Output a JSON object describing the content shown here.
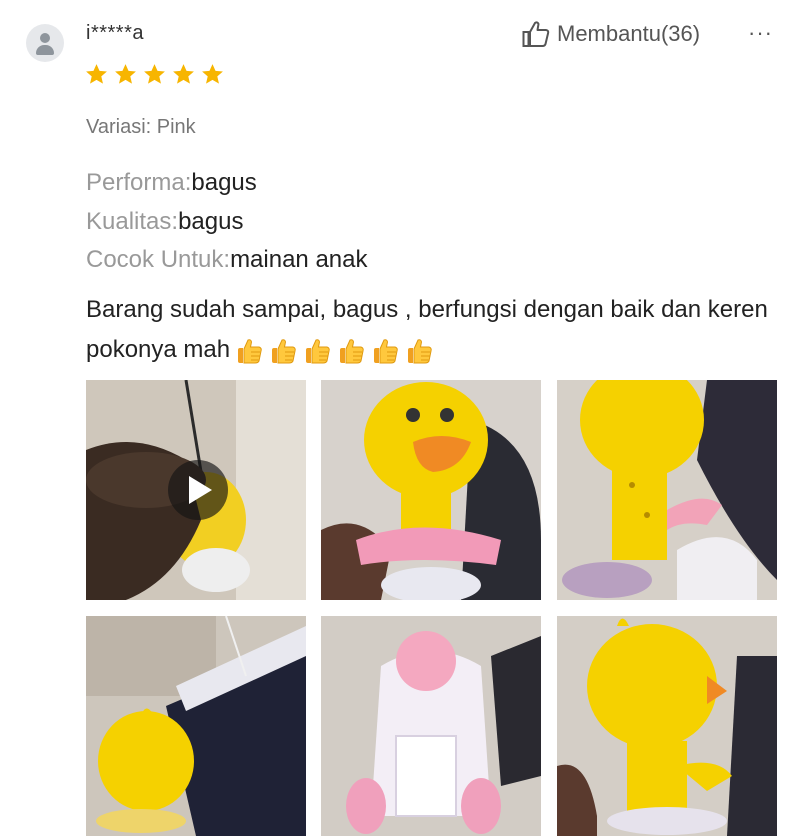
{
  "review": {
    "username": "i*****a",
    "rating": 5,
    "rating_max": 5,
    "helpful_label": "Membantu(36)",
    "more_label": "···",
    "variant": "Variasi: Pink",
    "attributes": [
      {
        "key": "Performa:",
        "value": "bagus"
      },
      {
        "key": "Kualitas:",
        "value": "bagus"
      },
      {
        "key": "Cocok Untuk:",
        "value": "mainan anak"
      }
    ],
    "text": "Barang sudah sampai, bagus , berfungsi dengan baik dan keren pokonya mah",
    "emoji_count": 6,
    "emoji_name": "thumbs-up-emoji"
  },
  "media": {
    "count": 6,
    "first_is_video": true
  },
  "colors": {
    "star": "#f7b500",
    "muted_text": "#999999",
    "duck_yellow": "#f5d100",
    "duck_beak": "#f08a24"
  }
}
